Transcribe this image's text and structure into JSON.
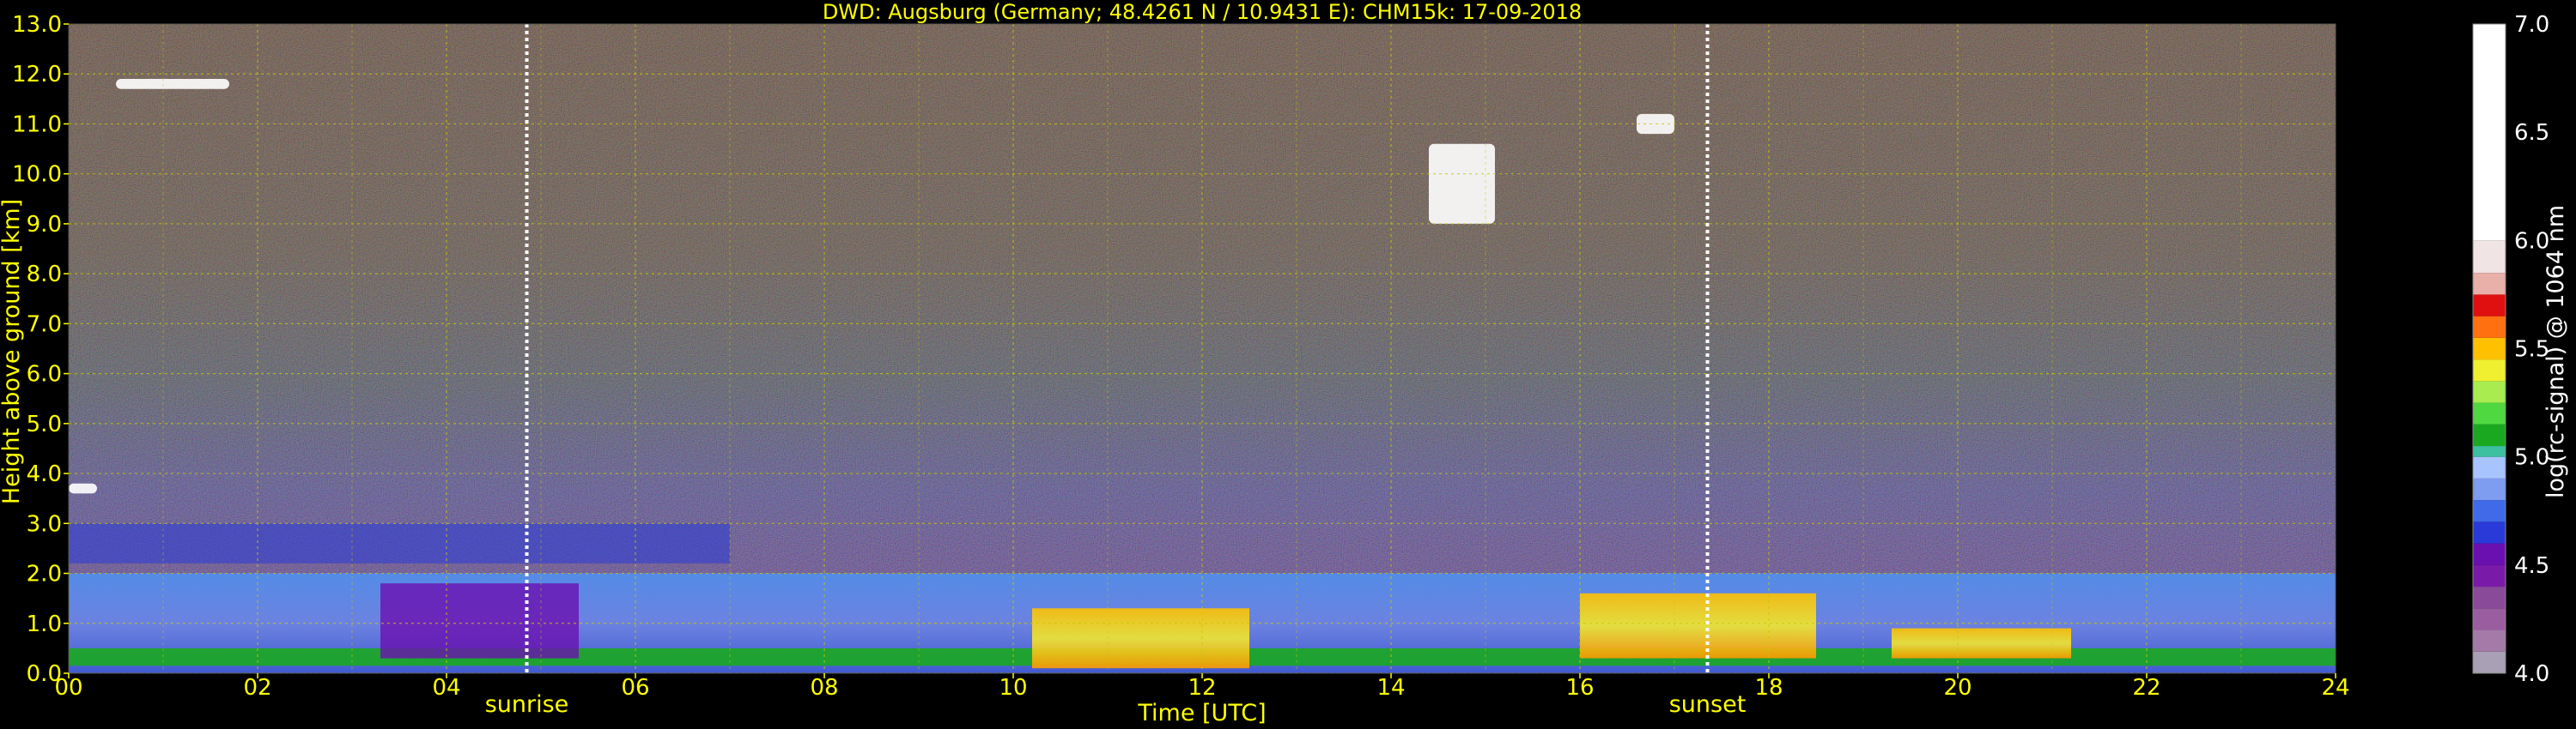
{
  "chart_data": {
    "type": "heatmap",
    "title": "DWD: Augsburg (Germany; 48.4261 N / 10.9431 E):    CHM15k: 17-09-2018",
    "xlabel": "Time [UTC]",
    "ylabel": "Height above ground [km]",
    "xlim": [
      0,
      24
    ],
    "ylim": [
      0,
      13
    ],
    "x_ticks": [
      "00",
      "02",
      "04",
      "06",
      "08",
      "10",
      "12",
      "14",
      "16",
      "18",
      "20",
      "22",
      "24"
    ],
    "x_tick_values": [
      0,
      2,
      4,
      6,
      8,
      10,
      12,
      14,
      16,
      18,
      20,
      22,
      24
    ],
    "y_ticks": [
      "0.0",
      "1.0",
      "2.0",
      "3.0",
      "4.0",
      "5.0",
      "6.0",
      "7.0",
      "8.0",
      "9.0",
      "10.0",
      "11.0",
      "12.0",
      "13.0"
    ],
    "y_tick_values": [
      0,
      1,
      2,
      3,
      4,
      5,
      6,
      7,
      8,
      9,
      10,
      11,
      12,
      13
    ],
    "grid": true,
    "annotations": [
      {
        "label": "sunrise",
        "time_utc": 4.85
      },
      {
        "label": "sunset",
        "time_utc": 17.35
      }
    ],
    "colorbar": {
      "label": "log(rc-signal) @ 1064 nm",
      "range": [
        4.0,
        7.0
      ],
      "ticks": [
        "4.0",
        "4.5",
        "5.0",
        "5.5",
        "6.0",
        "6.5",
        "7.0"
      ],
      "tick_values": [
        4.0,
        4.5,
        5.0,
        5.5,
        6.0,
        6.5,
        7.0
      ],
      "colors": [
        {
          "from": 4.0,
          "to": 4.1,
          "color": "#a9a0b5"
        },
        {
          "from": 4.1,
          "to": 4.2,
          "color": "#a47aa8"
        },
        {
          "from": 4.2,
          "to": 4.3,
          "color": "#9a5ea0"
        },
        {
          "from": 4.3,
          "to": 4.4,
          "color": "#8a4a9a"
        },
        {
          "from": 4.4,
          "to": 4.5,
          "color": "#7a1aa8"
        },
        {
          "from": 4.5,
          "to": 4.6,
          "color": "#6a10b0"
        },
        {
          "from": 4.6,
          "to": 4.7,
          "color": "#2a3ad8"
        },
        {
          "from": 4.7,
          "to": 4.8,
          "color": "#3f6ae8"
        },
        {
          "from": 4.8,
          "to": 4.9,
          "color": "#7e9cf0"
        },
        {
          "from": 4.9,
          "to": 5.0,
          "color": "#a8c4ff"
        },
        {
          "from": 5.0,
          "to": 5.05,
          "color": "#3cc0a0"
        },
        {
          "from": 5.05,
          "to": 5.15,
          "color": "#1aa820"
        },
        {
          "from": 5.15,
          "to": 5.25,
          "color": "#50d840"
        },
        {
          "from": 5.25,
          "to": 5.35,
          "color": "#a8ec50"
        },
        {
          "from": 5.35,
          "to": 5.45,
          "color": "#f0f030"
        },
        {
          "from": 5.45,
          "to": 5.55,
          "color": "#ffc000"
        },
        {
          "from": 5.55,
          "to": 5.65,
          "color": "#ff7010"
        },
        {
          "from": 5.65,
          "to": 5.75,
          "color": "#e01010"
        },
        {
          "from": 5.75,
          "to": 5.85,
          "color": "#e8b0a8"
        },
        {
          "from": 5.85,
          "to": 6.0,
          "color": "#f0e4e4"
        },
        {
          "from": 6.0,
          "to": 7.0,
          "color": "#ffffff"
        }
      ]
    },
    "features": [
      {
        "name": "noise",
        "t0": 0,
        "t1": 24,
        "h0": 4,
        "h1": 13,
        "value": 4.3
      },
      {
        "name": "residual_layer",
        "t0": 0,
        "t1": 7,
        "h0": 2.2,
        "h1": 3.0,
        "value": 4.6
      },
      {
        "name": "boundary_layer",
        "t0": 0,
        "t1": 24,
        "h0": 0,
        "h1": 2.0,
        "value": 4.8
      },
      {
        "name": "surface_green",
        "t0": 0,
        "t1": 24,
        "h0": 0.15,
        "h1": 0.5,
        "value": 5.1
      },
      {
        "name": "night_purple",
        "t0": 3.3,
        "t1": 5.4,
        "h0": 0.3,
        "h1": 1.8,
        "value": 4.5
      },
      {
        "name": "convective_yellow",
        "t0": 10.2,
        "t1": 12.5,
        "h0": 0.1,
        "h1": 1.3,
        "value": 5.4
      },
      {
        "name": "afternoon_yellow",
        "t0": 16.0,
        "t1": 18.5,
        "h0": 0.3,
        "h1": 1.6,
        "value": 5.4
      },
      {
        "name": "evening_yellow",
        "t0": 19.3,
        "t1": 21.2,
        "h0": 0.3,
        "h1": 0.9,
        "value": 5.4
      },
      {
        "name": "cirrus_cloud",
        "t0": 14.4,
        "t1": 15.1,
        "h0": 9.0,
        "h1": 10.6,
        "value": 6.5
      },
      {
        "name": "cirrus_cloud",
        "t0": 16.6,
        "t1": 17.0,
        "h0": 10.8,
        "h1": 11.2,
        "value": 6.5
      },
      {
        "name": "cirrus_cloud",
        "t0": 0.5,
        "t1": 1.7,
        "h0": 11.7,
        "h1": 11.9,
        "value": 6.5
      },
      {
        "name": "low_cloud",
        "t0": 0.0,
        "t1": 0.3,
        "h0": 3.6,
        "h1": 3.8,
        "value": 6.5
      }
    ]
  }
}
